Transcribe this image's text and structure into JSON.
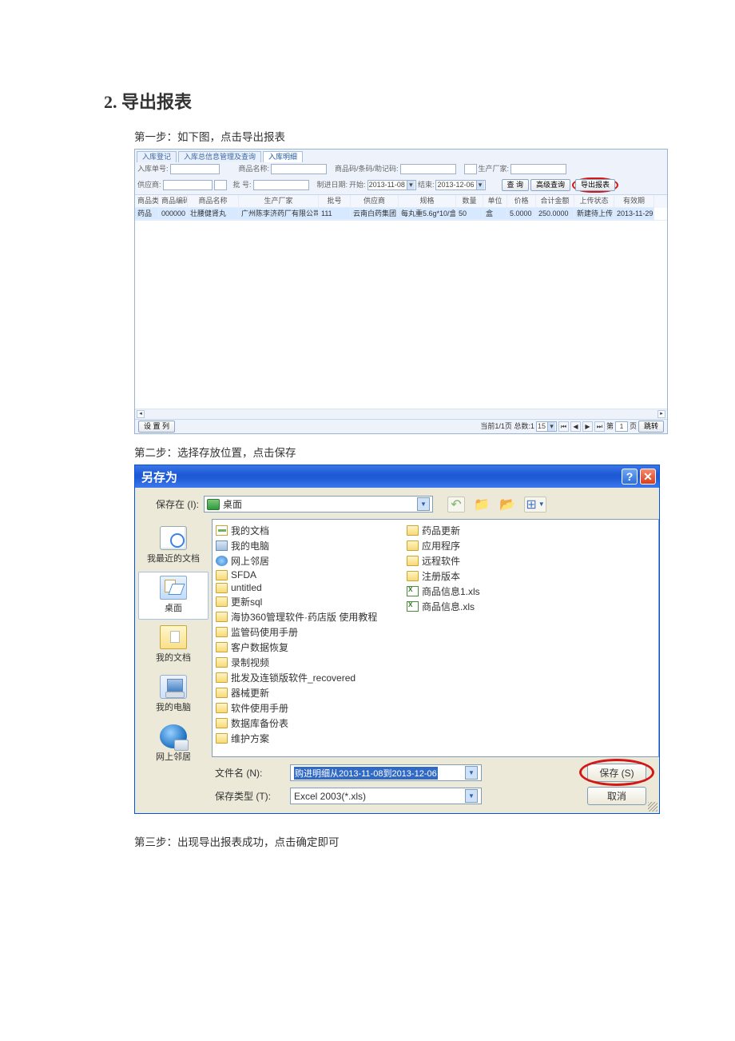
{
  "doc": {
    "heading": "2. 导出报表",
    "step1": "第一步：如下图，点击导出报表",
    "step2": "第二步：选择存放位置，点击保存",
    "step3": "第三步：出现导出报表成功，点击确定即可"
  },
  "shot1": {
    "tabs": [
      "入库登记",
      "入库总信息管理及查询",
      "入库明细"
    ],
    "active_tab": 2,
    "row1": {
      "l1": "入库单号:",
      "l2": "商品名称:",
      "l3": "商品码/条码/助记码:",
      "l4": "生产厂家:"
    },
    "row2": {
      "l1": "供应商:",
      "l2": "批 号:",
      "l3": "制进日期:",
      "d_start_lbl": "开始:",
      "d_start": "2013-11-08",
      "d_end_lbl": "结束:",
      "d_end": "2013-12-06",
      "btn_query": "查 询",
      "btn_advq": "高级查询",
      "btn_export": "导出报表"
    },
    "columns": [
      "商品类别",
      "商品编码",
      "商品名称",
      "生产厂家",
      "批号",
      "供应商",
      "规格",
      "数量",
      "单位",
      "价格",
      "合计金额",
      "上传状态",
      "有效期"
    ],
    "row": {
      "c1": "药品",
      "c2": "000000",
      "c3": "壮腰健肾丸",
      "c4": "广州陈李济药厂有限公司",
      "c5": "111",
      "c6": "云南白药集团",
      "c7": "每丸重5.6g*10/盒",
      "c8": "50",
      "c9": "盒",
      "c10": "5.0000",
      "c11": "250.0000",
      "c12": "新建待上传",
      "c13": "2013-11-29"
    },
    "footer": {
      "btn_setcol": "设 置 列",
      "pager_text": "当前1/1页 总数:1",
      "page_size": "15",
      "page_label": "第",
      "page_val": "1",
      "page_suffix": "页",
      "jump": "跳转"
    }
  },
  "shot2": {
    "title": "另存为",
    "save_in_label": "保存在 (I):",
    "save_in_value": "桌面",
    "places": {
      "recent": "我最近的文档",
      "desktop": "桌面",
      "docs": "我的文档",
      "pc": "我的电脑",
      "net": "网上邻居"
    },
    "col1": [
      {
        "t": "mydocs",
        "label": "我的文档"
      },
      {
        "t": "mypc",
        "label": "我的电脑"
      },
      {
        "t": "net",
        "label": "网上邻居"
      },
      {
        "t": "folder",
        "label": "SFDA"
      },
      {
        "t": "folder",
        "label": "untitled"
      },
      {
        "t": "folder",
        "label": "更新sql"
      },
      {
        "t": "folder",
        "label": "海协360管理软件·药店版 使用教程"
      },
      {
        "t": "folder",
        "label": "监管码使用手册"
      },
      {
        "t": "folder",
        "label": "客户数据恢复"
      },
      {
        "t": "folder",
        "label": "录制视频"
      },
      {
        "t": "folder",
        "label": "批发及连锁版软件_recovered"
      },
      {
        "t": "folder",
        "label": "器械更新"
      },
      {
        "t": "folder",
        "label": "软件使用手册"
      },
      {
        "t": "folder",
        "label": "数据库备份表"
      },
      {
        "t": "folder",
        "label": "维护方案"
      }
    ],
    "col2": [
      {
        "t": "folder",
        "label": "药品更新"
      },
      {
        "t": "folder",
        "label": "应用程序"
      },
      {
        "t": "folder",
        "label": "远程软件"
      },
      {
        "t": "folder",
        "label": "注册版本"
      },
      {
        "t": "xls",
        "label": "商品信息1.xls"
      },
      {
        "t": "xls",
        "label": "商品信息.xls"
      }
    ],
    "fname_label": "文件名 (N):",
    "fname_value": "购进明细从2013-11-08到2013-12-06",
    "ftype_label": "保存类型 (T):",
    "ftype_value": "Excel 2003(*.xls)",
    "btn_save": "保存 (S)",
    "btn_cancel": "取消"
  }
}
